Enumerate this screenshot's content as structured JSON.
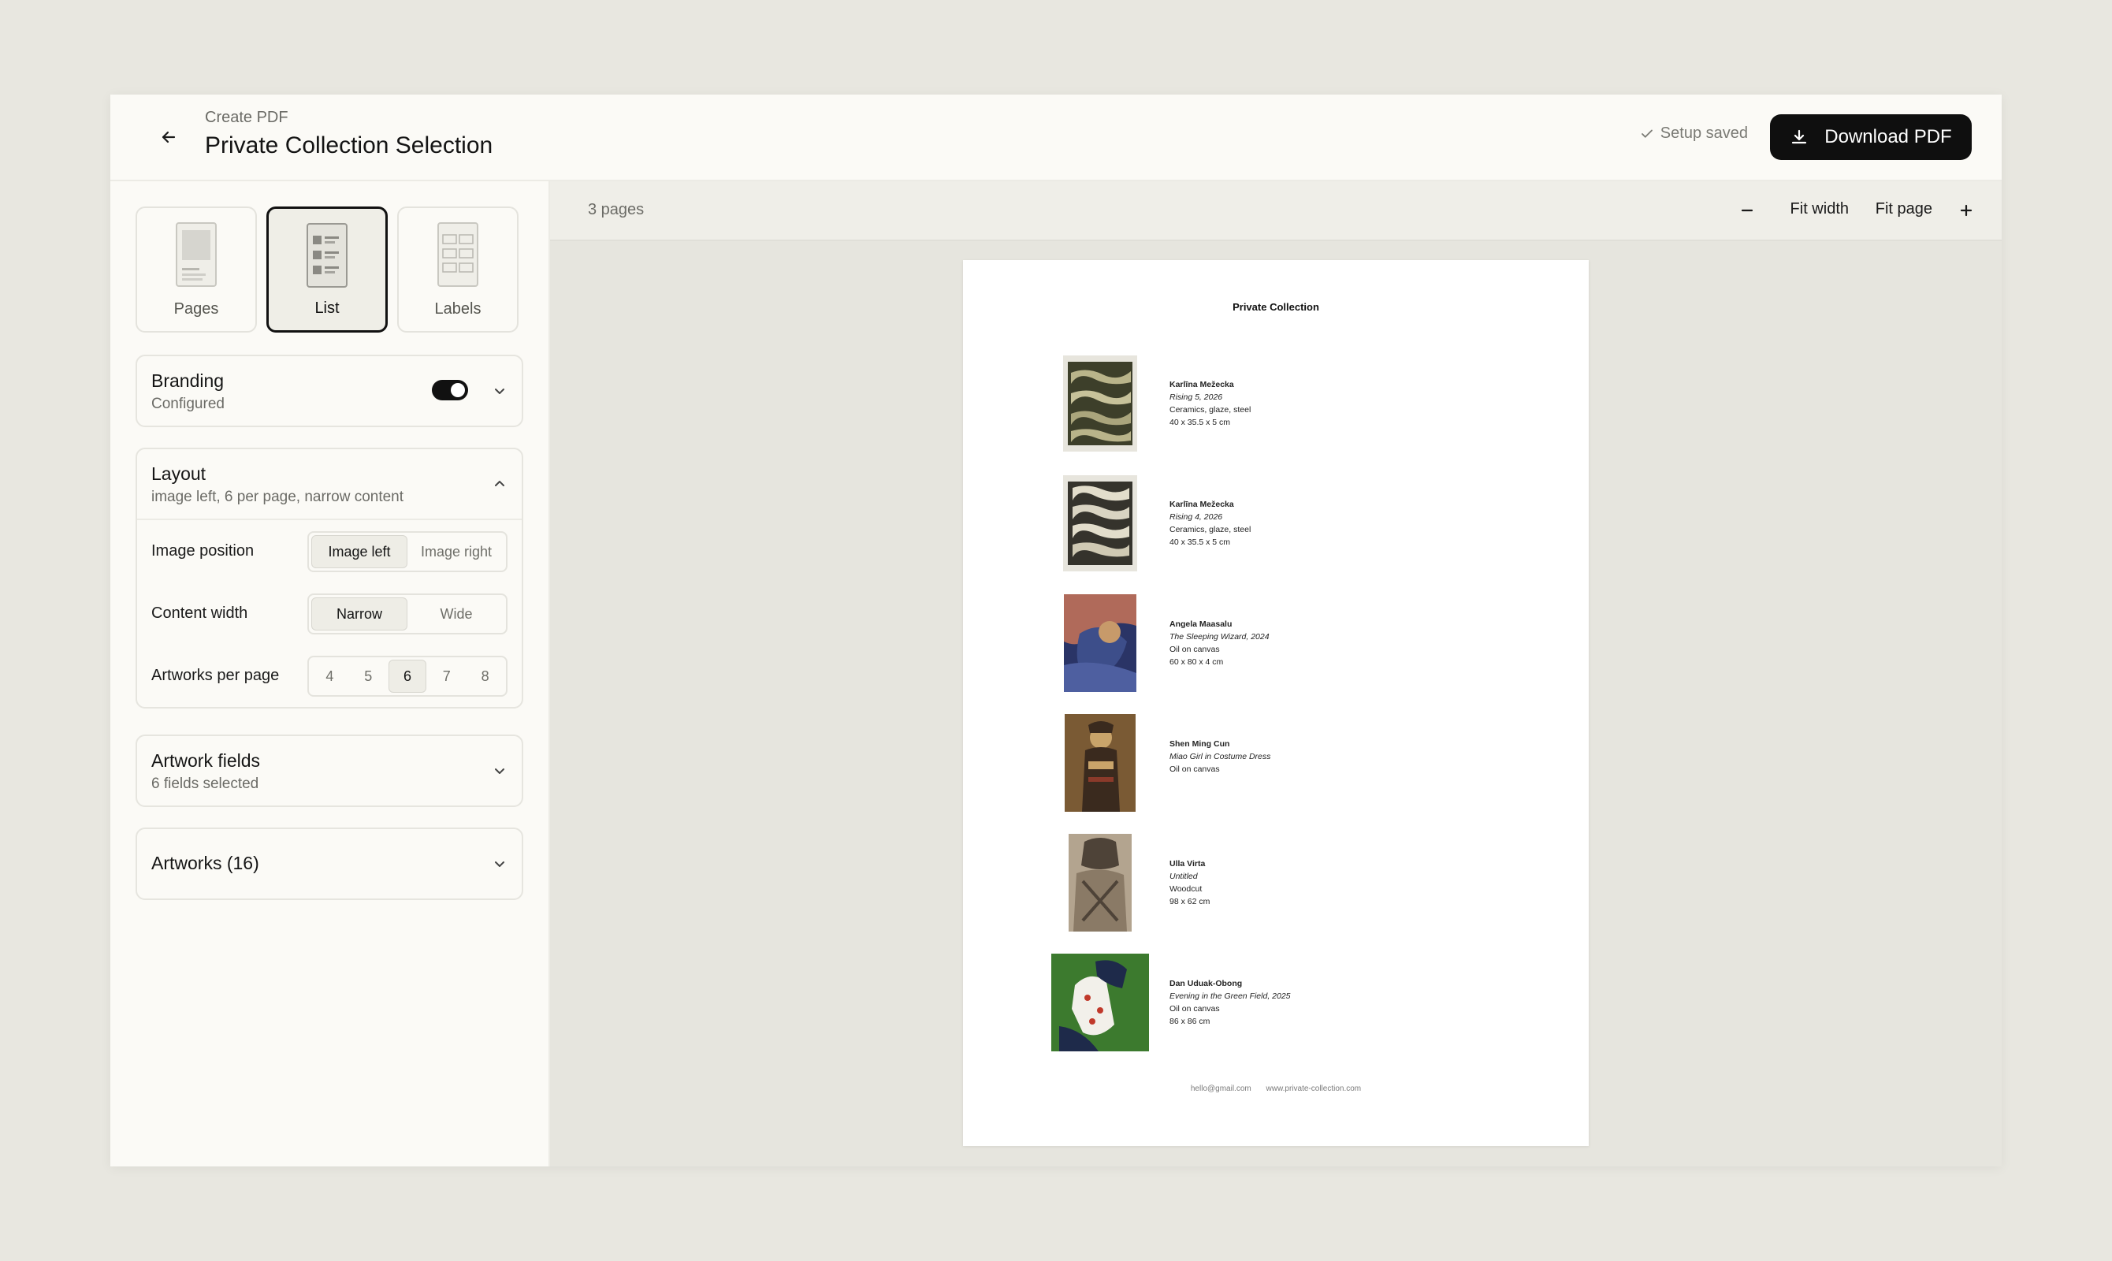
{
  "header": {
    "breadcrumb": "Create PDF",
    "title": "Private Collection Selection",
    "status": "Setup saved",
    "download_label": "Download PDF"
  },
  "modes": [
    {
      "label": "Pages",
      "icon": "pages-layout-icon",
      "selected": false
    },
    {
      "label": "List",
      "icon": "list-layout-icon",
      "selected": true
    },
    {
      "label": "Labels",
      "icon": "labels-layout-icon",
      "selected": false
    }
  ],
  "branding": {
    "title": "Branding",
    "subtitle": "Configured",
    "enabled": true
  },
  "layout": {
    "title": "Layout",
    "subtitle": "image left, 6 per page, narrow content",
    "image_position": {
      "label": "Image position",
      "options": [
        "Image left",
        "Image right"
      ],
      "selected": "Image left"
    },
    "content_width": {
      "label": "Content width",
      "options": [
        "Narrow",
        "Wide"
      ],
      "selected": "Narrow"
    },
    "per_page": {
      "label": "Artworks per page",
      "options": [
        "4",
        "5",
        "6",
        "7",
        "8"
      ],
      "selected": "6"
    }
  },
  "artwork_fields": {
    "title": "Artwork fields",
    "subtitle": "6 fields selected"
  },
  "artworks": {
    "title": "Artworks (16)"
  },
  "preview": {
    "pages_count": "3 pages",
    "fit_width": "Fit width",
    "fit_page": "Fit page",
    "doc_title": "Private Collection",
    "items": [
      {
        "artist": "Karlīna Mežecka",
        "title": "Rising 5, 2026",
        "medium": "Ceramics, glaze, steel",
        "size": "40 x 35.5 x 5 cm",
        "palette": [
          "#b9b48a",
          "#3d3f2a",
          "#8a8a5c"
        ]
      },
      {
        "artist": "Karlīna Mežecka",
        "title": "Rising 4, 2026",
        "medium": "Ceramics, glaze, steel",
        "size": "40 x 35.5 x 5 cm",
        "palette": [
          "#d9d4c2",
          "#35332c",
          "#a8a28a"
        ]
      },
      {
        "artist": "Angela Maasalu",
        "title": "The Sleeping Wizard, 2024",
        "medium": "Oil on canvas",
        "size": "60 x 80 x 4 cm",
        "palette": [
          "#3d4e8a",
          "#b06a5a",
          "#2a3466"
        ]
      },
      {
        "artist": "Shen Ming Cun",
        "title": "Miao Girl in Costume Dress",
        "medium": "Oil on canvas",
        "size": "",
        "palette": [
          "#7a5a34",
          "#c9a46a",
          "#3a2a1e"
        ]
      },
      {
        "artist": "Ulla Virta",
        "title": "Untitled",
        "medium": "Woodcut",
        "size": "98 x 62 cm",
        "palette": [
          "#8a7a66",
          "#4e4338",
          "#b3a48f"
        ]
      },
      {
        "artist": "Dan Uduak-Obong",
        "title": "Evening in the Green Field, 2025",
        "medium": "Oil on canvas",
        "size": "86 x 86 cm",
        "palette": [
          "#3c7a2e",
          "#f2f0ea",
          "#1e2a4a"
        ]
      }
    ],
    "footer_email": "hello@gmail.com",
    "footer_web": "www.private-collection.com"
  }
}
